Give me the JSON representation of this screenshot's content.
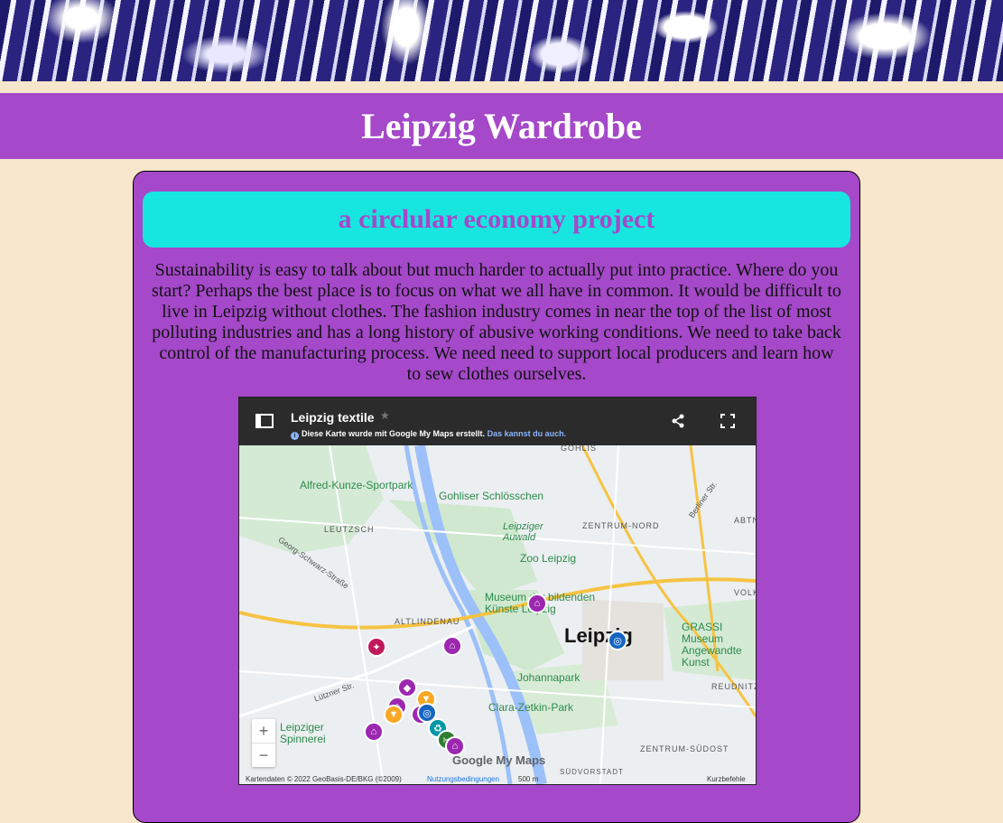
{
  "site": {
    "title": "Leipzig Wardrobe",
    "subtitle": "a circlular economy project",
    "intro": "Sustainability is easy to talk about but much harder to actually put into practice. Where do you start? Perhaps the best place is to focus on what we all have in common. It would be difficult to live in Leipzig without clothes. The fashion industry comes in near the top of the list of most polluting industries and has a long history of abusive working conditions. We need to take back control of the manufacturing process. We need need to support local producers and learn how to sew clothes ourselves."
  },
  "map": {
    "title": "Leipzig textile",
    "info_text": "Diese Karte wurde mit Google My Maps erstellt.",
    "info_link": "Das kannst du auch.",
    "labels": {
      "gohlis": "GOHLIS",
      "sportpark": "Alfred-Kunze-Sportpark",
      "schloesschen": "Gohliser Schlösschen",
      "leutzsch": "LEUTZSCH",
      "auwald": "Leipziger Auwald",
      "zentrum_nord": "ZENTRUM-NORD",
      "zoo": "Zoo Leipzig",
      "schwarz": "Georg-Schwarz-Straße",
      "museum": "Museum der bildenden Künste Leipzig",
      "altlindenau": "ALTLINDENAU",
      "leipzig": "Leipzig",
      "grassi": "GRASSI Museum Angewandte Kunst",
      "johannapark": "Johannapark",
      "reudnitz": "REUDNITZ",
      "clara": "Clara-Zetkin-Park",
      "spinnerei": "Leipziger Spinnerei",
      "zentrum_suedost": "ZENTRUM-SÜDOST",
      "suedvorstadt": "SÜDVORSTADT",
      "volk": "VOLK",
      "abtn": "ABTN",
      "luetzner": "Lützner Str.",
      "berliner": "Berliner Str."
    },
    "zoom_in": "+",
    "zoom_out": "−",
    "google_logo": "Google My Maps",
    "footer_data": "Kartendaten © 2022 GeoBasis-DE/BKG (©2009)",
    "footer_terms": "Nutzungsbedingungen",
    "footer_scale": "500 m",
    "footer_shortcuts": "Kurzbefehle"
  },
  "colors": {
    "page_bg": "#f7e6cb",
    "purple": "#a548c9",
    "cyan": "#17e6e0",
    "marker_purple": "#9c27b0",
    "marker_crimson": "#c2185b",
    "marker_amber": "#f9a825",
    "marker_blue": "#1565c0",
    "marker_teal": "#0097a7",
    "marker_green": "#2e7d32"
  }
}
